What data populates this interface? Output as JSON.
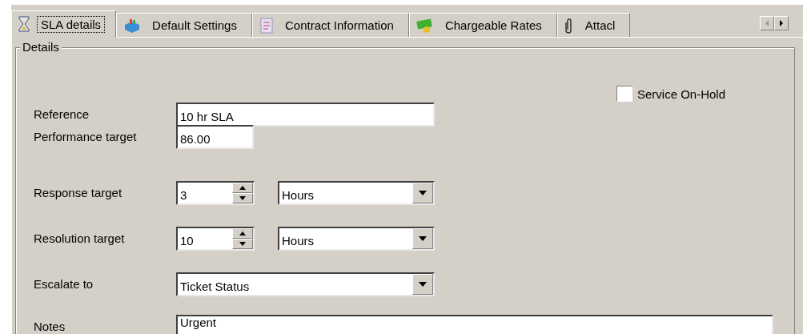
{
  "tabs": [
    {
      "label": "SLA details",
      "selected": true
    },
    {
      "label": "Default Settings",
      "selected": false
    },
    {
      "label": "Contract Information",
      "selected": false
    },
    {
      "label": "Chargeable Rates",
      "selected": false
    },
    {
      "label": "Attacl",
      "selected": false
    }
  ],
  "group_title": "Details",
  "reference": {
    "label": "Reference",
    "value": "10 hr SLA"
  },
  "service_on_hold": {
    "label": "Service On-Hold",
    "checked": false
  },
  "performance_target": {
    "label": "Performance target",
    "value": "86.00"
  },
  "response_target": {
    "label": "Response target",
    "value": "3",
    "unit": "Hours"
  },
  "resolution_target": {
    "label": "Resolution target",
    "value": "10",
    "unit": "Hours"
  },
  "escalate_to": {
    "label": "Escalate to",
    "value": "Ticket Status"
  },
  "notes": {
    "label": "Notes",
    "value": "Urgent"
  }
}
